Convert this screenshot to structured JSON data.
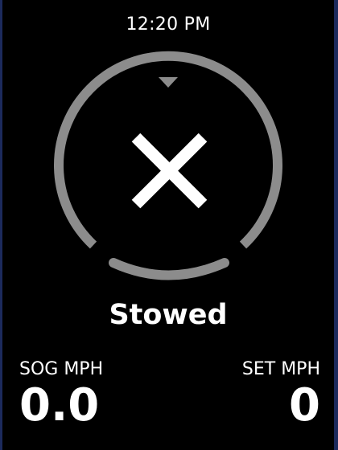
{
  "clock": {
    "time": "12:20 PM"
  },
  "motor": {
    "status_label": "Stowed",
    "status_icon": "x-mark-icon"
  },
  "readouts": {
    "sog": {
      "label": "SOG MPH",
      "value": "0.0"
    },
    "set": {
      "label": "SET MPH",
      "value": "0"
    }
  },
  "colors": {
    "background": "#000000",
    "ring": "#8c8c8c",
    "text": "#ffffff"
  }
}
